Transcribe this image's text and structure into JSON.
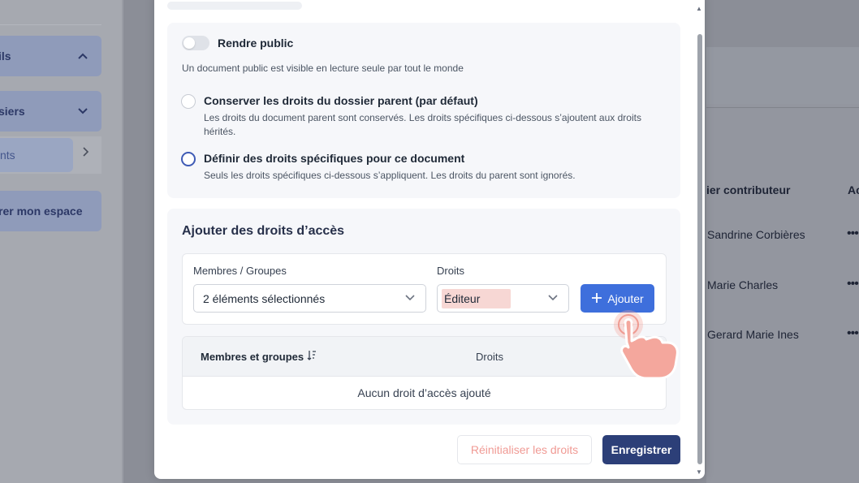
{
  "sidebar": {
    "item1_label": "ils",
    "item2_label": "siers",
    "sub_item_label": "nts",
    "item3_label": "rer mon espace"
  },
  "background_table": {
    "col1_header": "ier contributeur",
    "col2_header": "Ac",
    "rows": [
      {
        "name": "Sandrine Corbières",
        "actions": "•••"
      },
      {
        "name": "Marie Charles",
        "actions": "•••"
      },
      {
        "name": "Gerard Marie Ines",
        "actions": "•••"
      }
    ]
  },
  "modal": {
    "public": {
      "label": "Rendre public",
      "description": "Un document public est visible en lecture seule par tout le monde",
      "enabled": false
    },
    "options": [
      {
        "title": "Conserver les droits du dossier parent (par défaut)",
        "description": "Les droits du document parent sont conservés. Les droits spécifiques ci-dessous s’ajoutent aux droits hérités.",
        "selected": false
      },
      {
        "title": "Définir des droits spécifiques pour ce document",
        "description": "Seuls les droits spécifiques ci-dessous s’appliquent. Les droits du parent sont ignorés.",
        "selected": true
      }
    ],
    "access": {
      "title": "Ajouter des droits d’accès",
      "members_label": "Membres / Groupes",
      "members_value": "2 éléments sélectionnés",
      "rights_label": "Droits",
      "rights_value": "Éditeur",
      "add_button": "Ajouter",
      "table": {
        "col1": "Membres et groupes",
        "col2": "Droits",
        "empty_text": "Aucun droit d’accès ajouté"
      }
    },
    "reset_button": "Réinitialiser les droits",
    "save_button": "Enregistrer"
  },
  "colors": {
    "primary": "#3e6fdc",
    "save": "#2c3f78",
    "reset_text": "#f09a94",
    "pointer_hand": "#f4a79d"
  }
}
